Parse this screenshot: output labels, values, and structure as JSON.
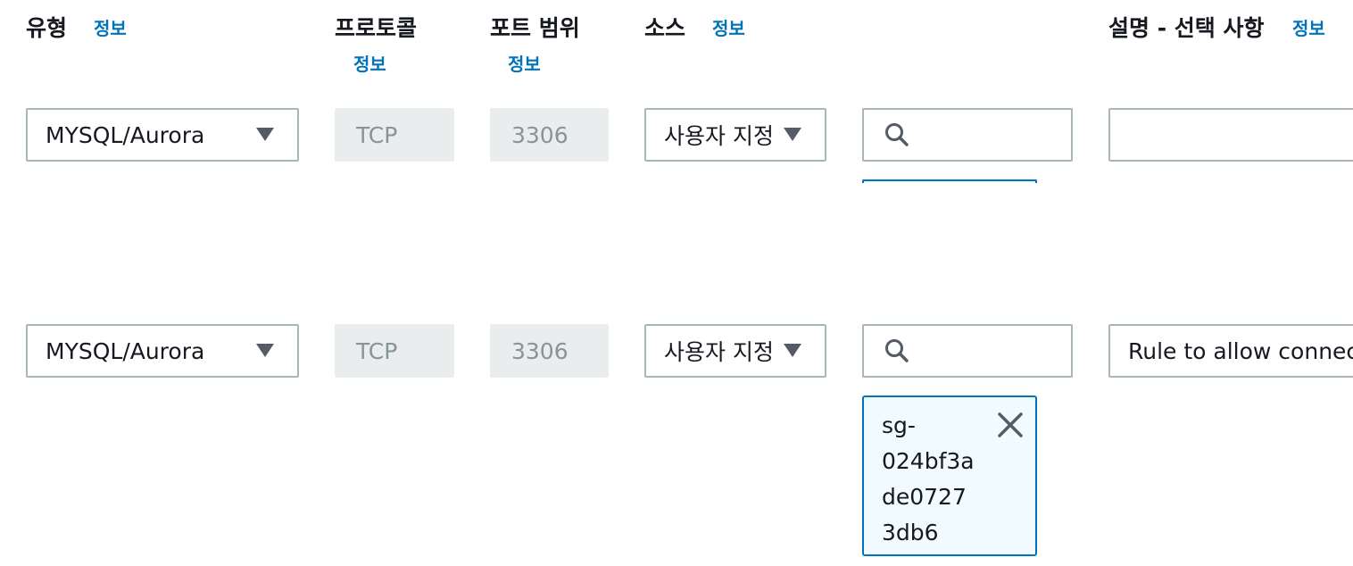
{
  "headers": {
    "type": "유형",
    "protocol": "프로토콜",
    "port_range": "포트 범위",
    "source": "소스",
    "description": "설명 - 선택 사항",
    "info_link": "정보"
  },
  "rules": [
    {
      "type": "MYSQL/Aurora",
      "protocol": "TCP",
      "port_range": "3306",
      "source_type": "사용자 지정",
      "source_search": "",
      "description": ""
    },
    {
      "type": "MYSQL/Aurora",
      "protocol": "TCP",
      "port_range": "3306",
      "source_type": "사용자 지정",
      "source_search": "",
      "description": "Rule to allow connec",
      "source_token": [
        "sg-",
        "024bf3a",
        "de0727",
        "3db6"
      ]
    }
  ],
  "colors": {
    "link": "#0073bb",
    "border": "#aab7b8",
    "disabled_bg": "#eaeded",
    "token_bg": "#f1faff"
  },
  "icons": {
    "dropdown": "caret-down-icon",
    "search": "search-icon",
    "remove_token": "close-icon"
  }
}
